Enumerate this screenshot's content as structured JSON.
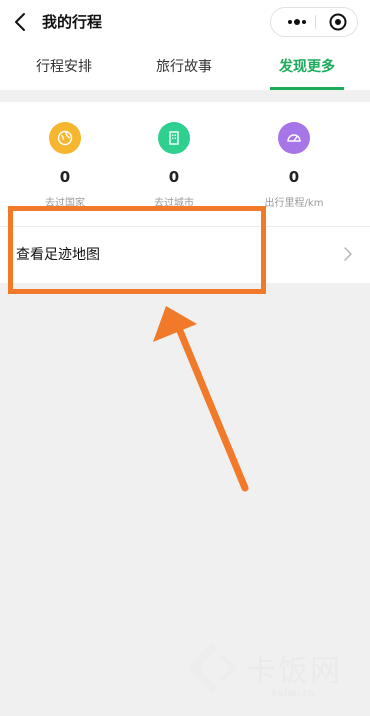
{
  "header": {
    "title": "我的行程"
  },
  "tabs": [
    {
      "label": "行程安排",
      "active": false
    },
    {
      "label": "旅行故事",
      "active": false
    },
    {
      "label": "发现更多",
      "active": true
    }
  ],
  "stats": [
    {
      "value": "0",
      "label": "去过国家",
      "icon": "globe-icon",
      "color": "#f6b62f"
    },
    {
      "value": "0",
      "label": "去过城市",
      "icon": "building-icon",
      "color": "#2fcf8f"
    },
    {
      "value": "0",
      "label": "出行里程/km",
      "icon": "speedometer-icon",
      "color": "#a675e8"
    }
  ],
  "footprint": {
    "label": "查看足迹地图"
  },
  "watermark": {
    "text": "卡饭网",
    "url": "kafan.cn"
  },
  "colors": {
    "accent": "#1bab5a",
    "highlight": "#f07a2a"
  }
}
